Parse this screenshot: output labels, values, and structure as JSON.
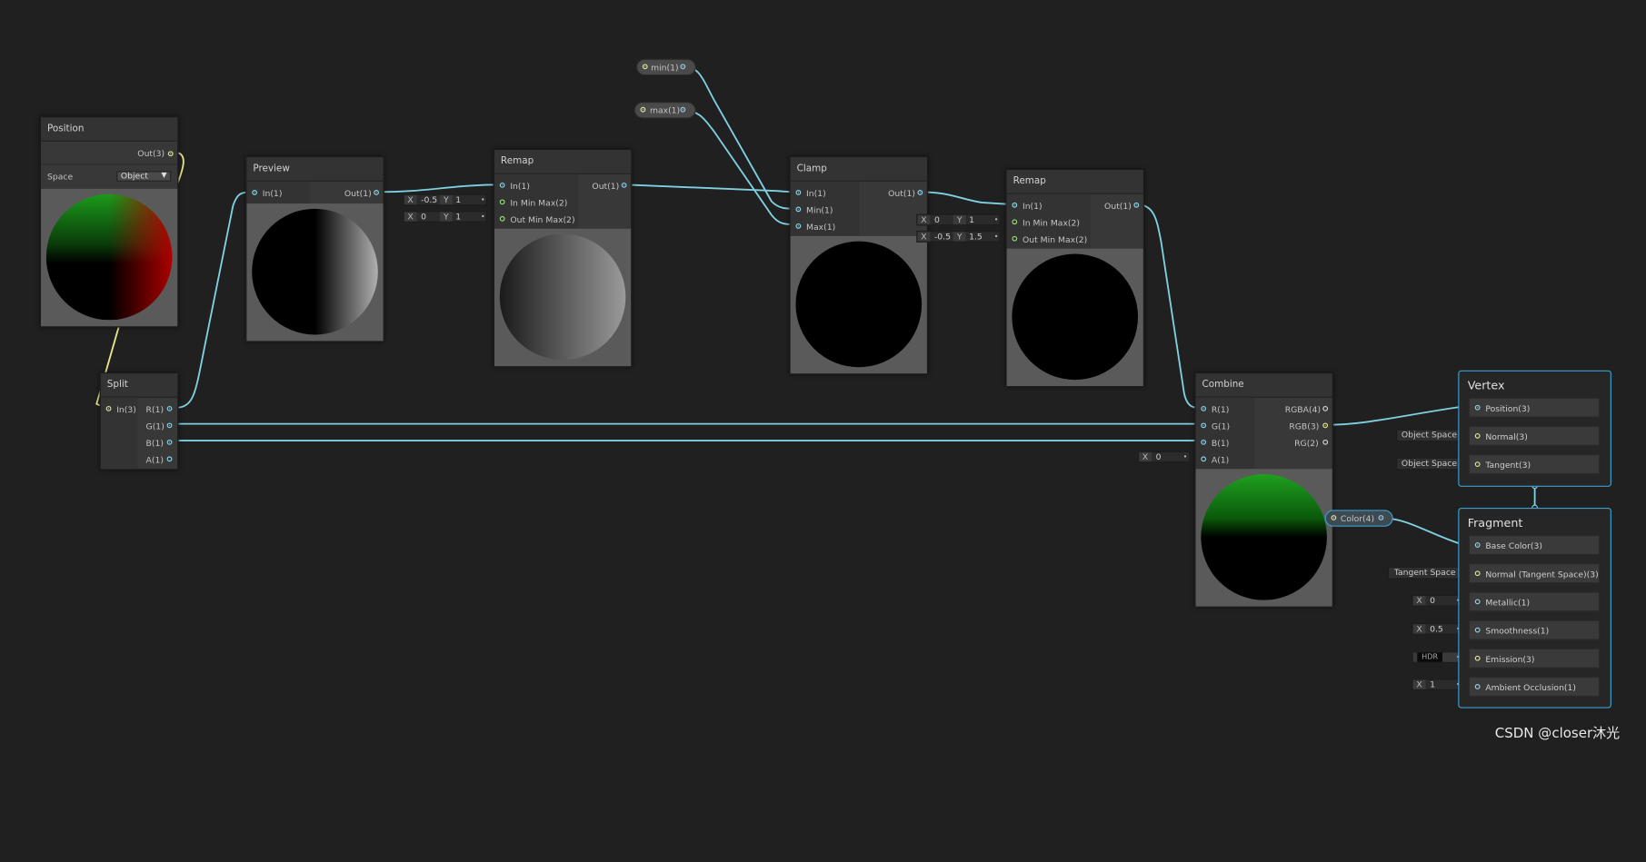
{
  "nodes": {
    "position": {
      "title": "Position",
      "out": "Out(3)",
      "space_label": "Space",
      "space_value": "Object"
    },
    "split": {
      "title": "Split",
      "input": "In(3)",
      "outputs": [
        "R(1)",
        "G(1)",
        "B(1)",
        "A(1)"
      ]
    },
    "preview": {
      "title": "Preview",
      "input": "In(1)",
      "output": "Out(1)"
    },
    "remap1": {
      "title": "Remap",
      "inputs": [
        "In(1)",
        "In Min Max(2)",
        "Out Min Max(2)"
      ],
      "output": "Out(1)",
      "fields": [
        {
          "x": "-0.5",
          "y": "1"
        },
        {
          "x": "0",
          "y": "1"
        }
      ]
    },
    "min_prop": {
      "label": "min(1)"
    },
    "max_prop": {
      "label": "max(1)"
    },
    "clamp": {
      "title": "Clamp",
      "inputs": [
        "In(1)",
        "Min(1)",
        "Max(1)"
      ],
      "output": "Out(1)"
    },
    "remap2": {
      "title": "Remap",
      "inputs": [
        "In(1)",
        "In Min Max(2)",
        "Out Min Max(2)"
      ],
      "output": "Out(1)",
      "fields": [
        {
          "x": "0",
          "y": "1"
        },
        {
          "x": "-0.5",
          "y": "1.5"
        }
      ]
    },
    "combine": {
      "title": "Combine",
      "inputs": [
        "R(1)",
        "G(1)",
        "B(1)",
        "A(1)"
      ],
      "outputs": [
        "RGBA(4)",
        "RGB(3)",
        "RG(2)"
      ],
      "a_value": "0"
    },
    "color_prop": {
      "label": "Color(4)"
    }
  },
  "axis_letters": {
    "x": "X",
    "y": "Y"
  },
  "vertex": {
    "title": "Vertex",
    "ports": [
      {
        "label": "Position(3)",
        "side": ""
      },
      {
        "label": "Normal(3)",
        "side": "Object Space"
      },
      {
        "label": "Tangent(3)",
        "side": "Object Space"
      }
    ]
  },
  "fragment": {
    "title": "Fragment",
    "ports": [
      {
        "label": "Base Color(3)",
        "side": ""
      },
      {
        "label": "Normal (Tangent Space)(3)",
        "side": "Tangent Space"
      },
      {
        "label": "Metallic(1)",
        "side": "0"
      },
      {
        "label": "Smoothness(1)",
        "side": "0.5"
      },
      {
        "label": "Emission(3)",
        "side": "HDR"
      },
      {
        "label": "Ambient Occlusion(1)",
        "side": "1"
      }
    ]
  },
  "colors": {
    "background": "#202020",
    "wire_blue": "#7fd0e0",
    "wire_yellow": "#e6e88a",
    "master_border": "#3aa0d0"
  },
  "watermark": "CSDN @closer沐光"
}
